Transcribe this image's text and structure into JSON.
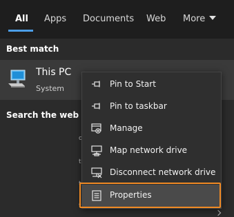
{
  "tabs": [
    {
      "label": "All"
    },
    {
      "label": "Apps"
    },
    {
      "label": "Documents"
    },
    {
      "label": "Web"
    },
    {
      "label": "More"
    }
  ],
  "best_match": {
    "heading": "Best match",
    "title": "This PC",
    "subtitle": "System",
    "icon": "computer-icon"
  },
  "search_web": {
    "heading": "Search the web",
    "partial_fragments": [
      "o",
      "t",
      "t",
      "t"
    ]
  },
  "context_menu": {
    "items": [
      {
        "label": "Pin to Start",
        "icon": "pin-icon"
      },
      {
        "label": "Pin to taskbar",
        "icon": "pin-icon"
      },
      {
        "label": "Manage",
        "icon": "manage-icon"
      },
      {
        "label": "Map network drive",
        "icon": "network-drive-icon"
      },
      {
        "label": "Disconnect network drive",
        "icon": "network-drive-disconnect-icon"
      },
      {
        "label": "Properties",
        "icon": "properties-icon"
      }
    ],
    "selected_item": "Properties",
    "highlight_color": "#f08a24"
  },
  "colors": {
    "background": "#2b2b2b",
    "tabbar": "#1e1e1e",
    "accent": "#4c9fe8"
  }
}
